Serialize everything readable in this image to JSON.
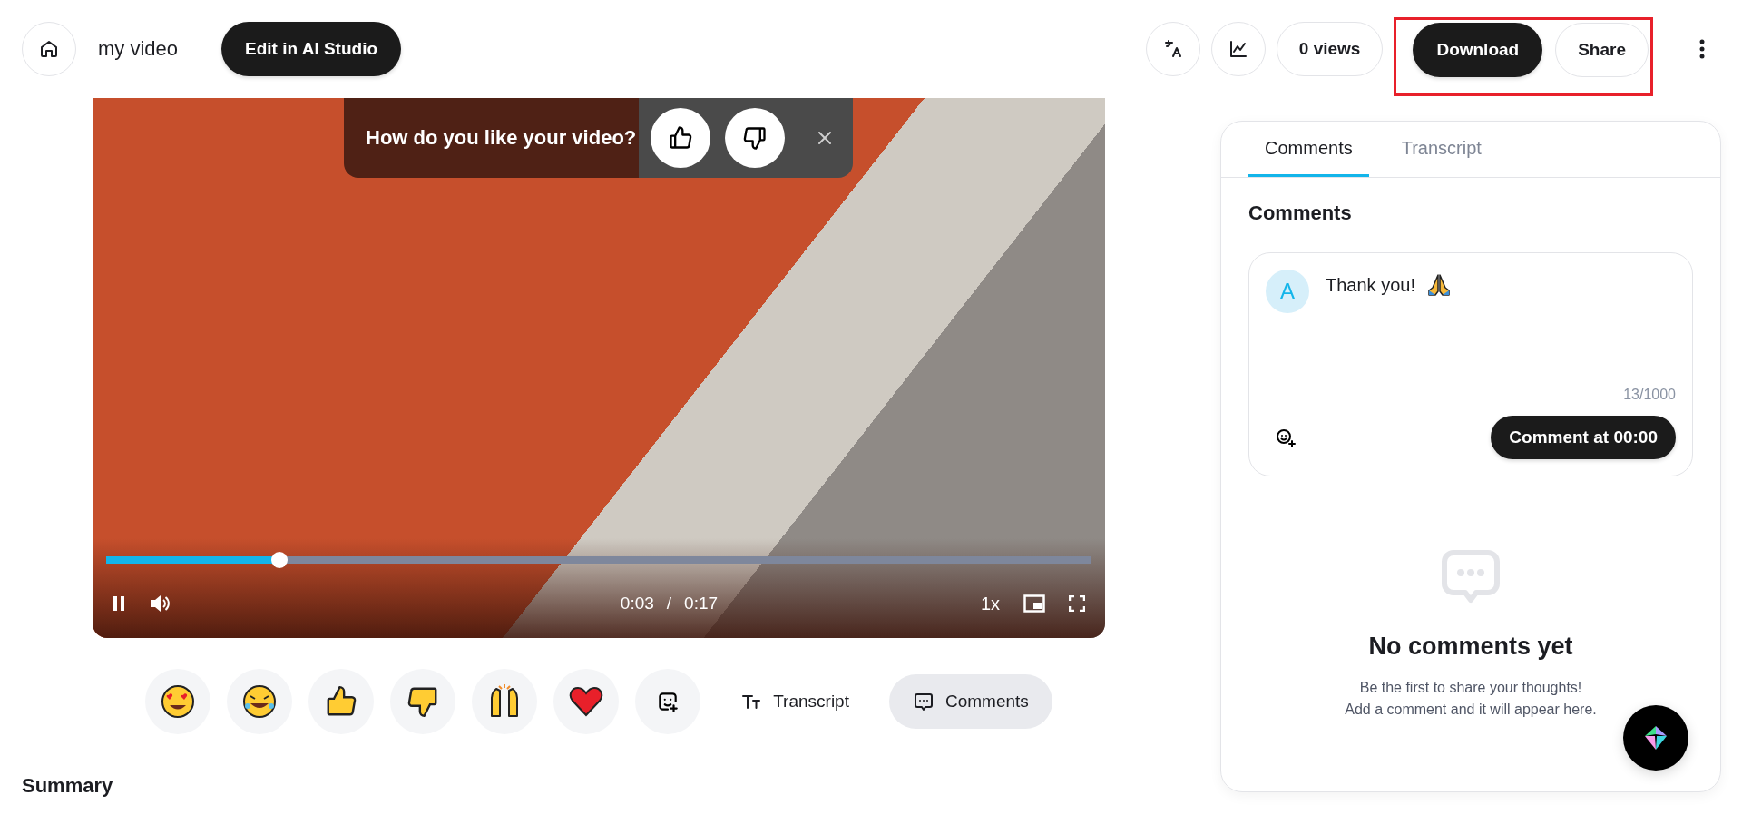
{
  "header": {
    "title": "my video",
    "edit_button": "Edit in AI Studio",
    "views": "0 views",
    "download_button": "Download",
    "share_button": "Share",
    "highlighted": true
  },
  "video": {
    "feedback": {
      "question": "How do you like your video?"
    },
    "player": {
      "playing": true,
      "level": 0.176,
      "current_time": "0:03",
      "separator": "/",
      "duration": "0:17",
      "speed": "1x"
    }
  },
  "view_buttons": [
    {
      "kind": "transcript",
      "label": "Transcript",
      "selected": false
    },
    {
      "kind": "comments",
      "label": "Comments",
      "selected": true
    }
  ],
  "summary_heading": "Summary",
  "panel": {
    "tabs": [
      {
        "label": "Comments",
        "selected": true
      },
      {
        "label": "Transcript",
        "selected": false
      }
    ],
    "heading": "Comments",
    "composer": {
      "avatar": "A",
      "value": "Thank you!",
      "counter": "13/1000",
      "submit": "Comment at 00:00"
    },
    "empty_state": {
      "title": "No comments yet",
      "lines": [
        "Be the first to share your thoughts!",
        "Add a comment and it will appear here."
      ]
    }
  }
}
